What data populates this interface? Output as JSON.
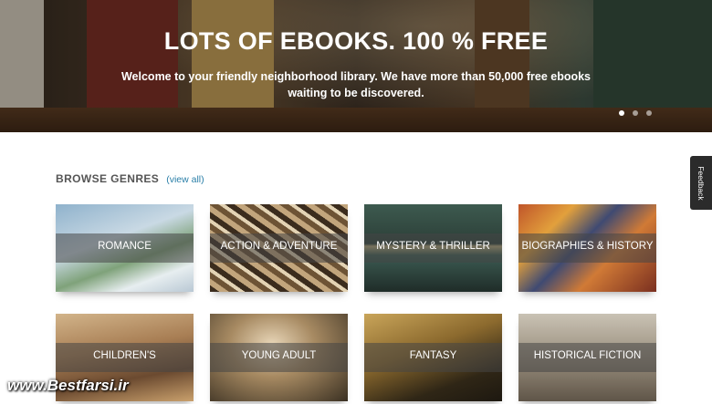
{
  "hero": {
    "title": "LOTS OF EBOOKS. 100 % FREE",
    "subtitle": "Welcome to your friendly neighborhood library. We have more than 50,000 free ebooks waiting to be discovered.",
    "slides": 3,
    "active_slide": 1
  },
  "browse": {
    "title": "BROWSE GENRES",
    "view_all": "(view all)"
  },
  "genres": [
    {
      "label": "ROMANCE"
    },
    {
      "label": "ACTION & ADVENTURE"
    },
    {
      "label": "MYSTERY & THRILLER"
    },
    {
      "label": "BIOGRAPHIES & HISTORY"
    },
    {
      "label": "CHILDREN'S"
    },
    {
      "label": "YOUNG ADULT"
    },
    {
      "label": "FANTASY"
    },
    {
      "label": "HISTORICAL FICTION"
    }
  ],
  "feedback": {
    "label": "Feedback"
  },
  "watermark": {
    "text": "www.Bestfarsi.ir"
  },
  "colors": {
    "link": "#2a7fa8",
    "heading": "#555555",
    "feedback_bg": "#2b2b2b"
  }
}
